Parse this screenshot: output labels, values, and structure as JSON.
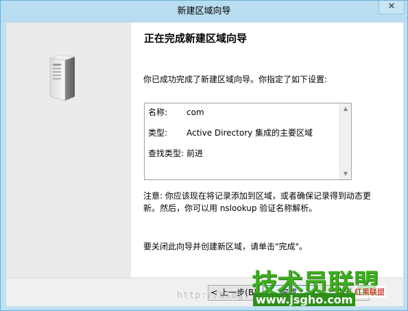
{
  "window": {
    "title": "新建区域向导",
    "close_glyph": "✕"
  },
  "wizard": {
    "heading": "正在完成新建区域向导",
    "intro": "你已成功完成了新建区域向导。你指定了如下设置:",
    "summary": [
      {
        "label": "名称:",
        "value": "com"
      },
      {
        "label": "类型:",
        "value": "Active Directory 集成的主要区域"
      },
      {
        "label": "查找类型:",
        "value": "前进"
      }
    ],
    "note": "注意: 你应该现在将记录添加到区域，或者确保记录得到动态更新。然后，你可以用 nslookup 验证名称解析。",
    "closing": "要关闭此向导并创建新区域，请单击\"完成\"。"
  },
  "buttons": {
    "back": "< 上一步(B)",
    "finish": "完成",
    "cancel": "取消"
  },
  "watermark": {
    "url": "http://blog.",
    "logo_big": "技术员联盟",
    "logo_small": "www.jsgho.com",
    "logo_red": "红黑联盟"
  },
  "icons": {
    "server": "server-icon",
    "scroll_up": "scroll-up-icon",
    "scroll_down": "scroll-down-icon"
  },
  "colors": {
    "titlebar": "#b9ddf0",
    "side_panel": "#ebebeb",
    "watermark_green": "#3fae1f"
  }
}
